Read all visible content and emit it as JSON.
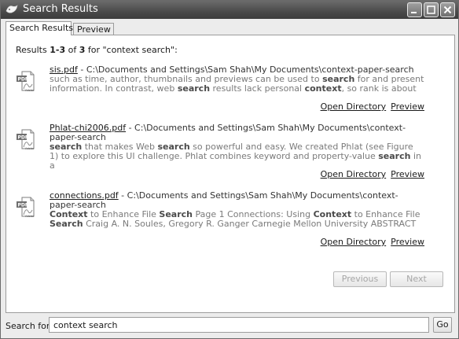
{
  "window": {
    "title": "Search Results",
    "icon": "app-icon",
    "controls": [
      "minimize-icon",
      "maximize-icon",
      "close-icon"
    ]
  },
  "tabs": [
    {
      "label": "Search Results",
      "active": true
    },
    {
      "label": "Preview",
      "active": false
    }
  ],
  "summary": {
    "prefix": "Results ",
    "range": "1-3",
    "of": " of ",
    "total": "3",
    "suffix": " for \"context search\":"
  },
  "results": [
    {
      "file": "sis.pdf",
      "path": " - C:\\Documents and Settings\\Sam Shah\\My Documents\\context-paper-search",
      "snippet": [
        {
          "t": "such as time, author, thumbnails and previews can be used to ",
          "b": false
        },
        {
          "t": "search",
          "b": true
        },
        {
          "t": " for and present information. In contrast, web ",
          "b": false
        },
        {
          "t": "search",
          "b": true
        },
        {
          "t": " results lack personal ",
          "b": false
        },
        {
          "t": "context",
          "b": true
        },
        {
          "t": ", so rank is about",
          "b": false
        }
      ],
      "open_directory": "Open Directory",
      "preview": "Preview"
    },
    {
      "file": "Phlat-chi2006.pdf",
      "path": " - C:\\Documents and Settings\\Sam Shah\\My Documents\\context-paper-search",
      "snippet": [
        {
          "t": "search",
          "b": true
        },
        {
          "t": " that makes Web ",
          "b": false
        },
        {
          "t": "search",
          "b": true
        },
        {
          "t": " so powerful and easy. We created Phlat (see Figure 1) to explore this UI challenge. Phlat combines keyword and property-value ",
          "b": false
        },
        {
          "t": "search",
          "b": true
        },
        {
          "t": " in a",
          "b": false
        }
      ],
      "open_directory": "Open Directory",
      "preview": "Preview"
    },
    {
      "file": "connections.pdf",
      "path": " - C:\\Documents and Settings\\Sam Shah\\My Documents\\context-paper-search",
      "snippet": [
        {
          "t": "Context",
          "b": true
        },
        {
          "t": " to Enhance File ",
          "b": false
        },
        {
          "t": "Search",
          "b": true
        },
        {
          "t": " Page 1 Connections: Using ",
          "b": false
        },
        {
          "t": "Context",
          "b": true
        },
        {
          "t": " to Enhance File ",
          "b": false
        },
        {
          "t": "Search",
          "b": true
        },
        {
          "t": " Craig A. N. Soules, Gregory R. Ganger Carnegie Mellon University ABSTRACT",
          "b": false
        }
      ],
      "open_directory": "Open Directory",
      "preview": "Preview"
    }
  ],
  "pager": {
    "previous": "Previous",
    "next": "Next"
  },
  "search": {
    "label": "Search for:",
    "value": "context search",
    "go": "Go"
  },
  "colors": {
    "titlebar": "#4a4a4a",
    "panel": "#ffffff",
    "frame": "#ececec",
    "snippet": "#7a7a7a"
  }
}
